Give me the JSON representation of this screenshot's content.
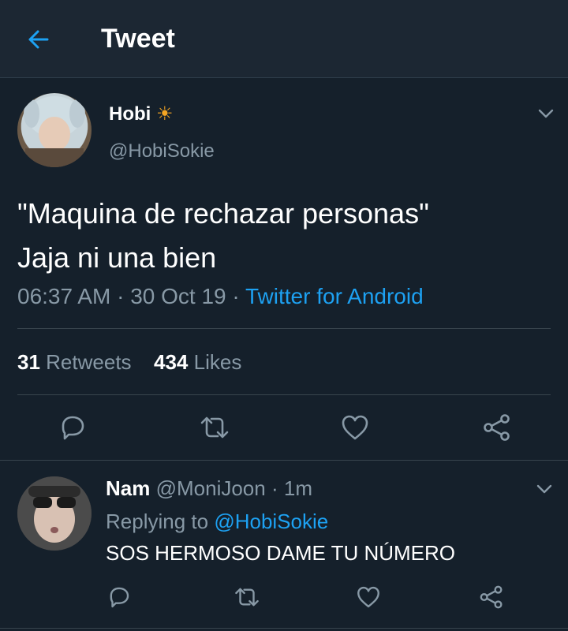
{
  "header": {
    "title": "Tweet",
    "back_icon": "arrow-left-icon"
  },
  "tweet": {
    "author_name": "Hobi",
    "author_emoji": "☀",
    "author_handle": "@HobiSokie",
    "text_line1": "\"Maquina de rechazar personas\"",
    "text_line2": "Jaja ni una bien",
    "time": "06:37 AM",
    "sep1": "·",
    "date": "30 Oct 19",
    "sep2": "·",
    "source": "Twitter for Android",
    "retweets_count": "31",
    "retweets_label": "Retweets",
    "likes_count": "434",
    "likes_label": "Likes"
  },
  "reply": {
    "author_name": "Nam",
    "author_handle": "@MoniJoon",
    "sep": "·",
    "time": "1m",
    "replying_to_label": "Replying to",
    "replying_to_handle": "@HobiSokie",
    "text": "SOS HERMOSO DAME TU NÚMERO"
  },
  "colors": {
    "background": "#15202b",
    "header_bg": "#1c2733",
    "accent": "#1da1f2",
    "muted": "#8899a6",
    "divider": "#38444d"
  },
  "icons": [
    "arrow-left-icon",
    "chevron-down-icon",
    "reply-icon",
    "retweet-icon",
    "like-icon",
    "share-icon"
  ]
}
